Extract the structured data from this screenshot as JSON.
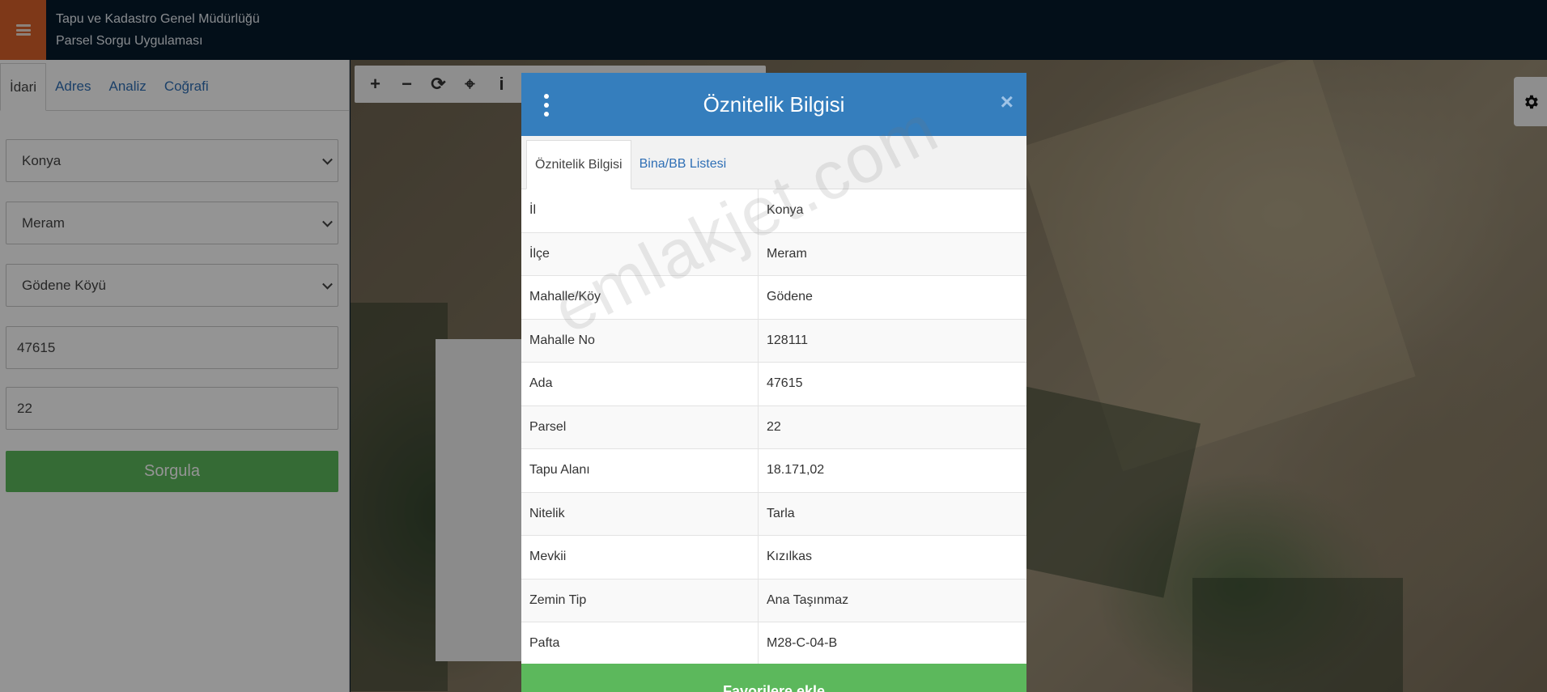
{
  "header": {
    "title_line1": "Tapu ve Kadastro Genel Müdürlüğü",
    "title_line2": "Parsel Sorgu Uygulaması"
  },
  "left_panel": {
    "tabs": [
      {
        "label": "İdari"
      },
      {
        "label": "Adres"
      },
      {
        "label": "Analiz"
      },
      {
        "label": "Coğrafi"
      }
    ],
    "fields": {
      "il": "Konya",
      "ilce": "Meram",
      "mahalle": "Gödene Köyü",
      "ada": "47615",
      "parsel": "22"
    },
    "query_button": "Sorgula"
  },
  "modal": {
    "title": "Öznitelik Bilgisi",
    "close": "×",
    "tabs": [
      {
        "label": "Öznitelik Bilgisi"
      },
      {
        "label": "Bina/BB Listesi"
      }
    ],
    "rows": [
      {
        "key": "İl",
        "value": "Konya"
      },
      {
        "key": "İlçe",
        "value": "Meram"
      },
      {
        "key": "Mahalle/Köy",
        "value": "Gödene"
      },
      {
        "key": "Mahalle No",
        "value": "128111"
      },
      {
        "key": "Ada",
        "value": "47615"
      },
      {
        "key": "Parsel",
        "value": "22"
      },
      {
        "key": "Tapu Alanı",
        "value": "18.171,02"
      },
      {
        "key": "Nitelik",
        "value": "Tarla"
      },
      {
        "key": "Mevkii",
        "value": "Kızılkas"
      },
      {
        "key": "Zemin Tip",
        "value": "Ana Taşınmaz"
      },
      {
        "key": "Pafta",
        "value": "M28-C-04-B"
      }
    ],
    "footer_button": "Favorilere ekle"
  },
  "map_toolbar": {
    "zoom_in": "+",
    "zoom_out": "−",
    "refresh": "⟳",
    "locate": "⌖",
    "info": "i"
  },
  "watermark": "emlakjet.com",
  "colors": {
    "header_bg": "#061a2b",
    "menu_accent": "#d9612a",
    "modal_header": "#357ebd",
    "success_green": "#5cb85c",
    "link_blue": "#2f6fb5"
  }
}
